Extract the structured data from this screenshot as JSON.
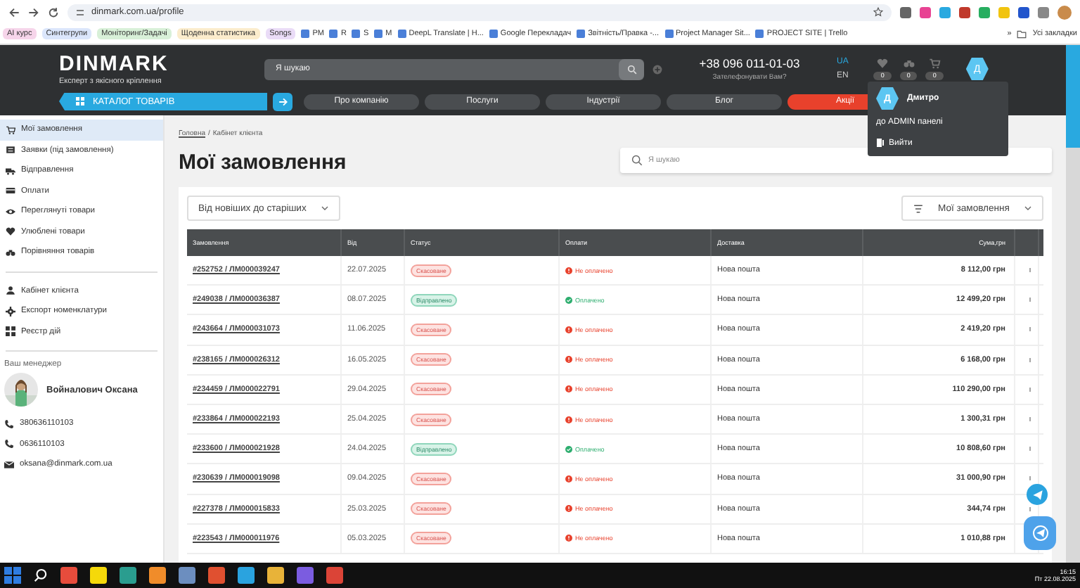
{
  "browser": {
    "url": "dinmark.com.ua/profile",
    "bookmark_tags": [
      {
        "label": "AI курс",
        "color": "#f6d5ea"
      },
      {
        "label": "Синтегрупи",
        "color": "#dbe6fb"
      },
      {
        "label": "Моніторинг/Задачі",
        "color": "#d8f0d8"
      },
      {
        "label": "Щоденна статистика",
        "color": "#fbeccc"
      },
      {
        "label": "Songs",
        "color": "#eadcf7"
      }
    ],
    "bookmark_links": [
      "PM",
      "R",
      "S",
      "M",
      "DeepL Translate | H...",
      "Google Перекладач",
      "Звітність/Правка -...",
      "Project Manager Sit...",
      "PROJECT SITE | Trello"
    ],
    "more": "»",
    "all_bookmarks": "Усі закладки"
  },
  "header": {
    "logo": "DINMARK",
    "tagline": "Експерт з якісного кріплення",
    "search_placeholder": "Я шукаю",
    "phone": "+38 096 011-01-03",
    "callback": "Зателефонувати Вам?",
    "languages": [
      {
        "label": "UA",
        "selected": true
      },
      {
        "label": "EN",
        "selected": false
      }
    ],
    "counters": [
      "0",
      "0",
      "0"
    ],
    "avatar": "Д"
  },
  "nav": {
    "catalog": "КАТАЛОГ ТОВАРІВ",
    "items": [
      {
        "label": "Про компанію",
        "kind": "normal"
      },
      {
        "label": "Послуги",
        "kind": "normal"
      },
      {
        "label": "Індустрії",
        "kind": "normal"
      },
      {
        "label": "Блог",
        "kind": "normal"
      },
      {
        "label": "Акції",
        "kind": "promo"
      }
    ]
  },
  "user_menu": {
    "avatar": "Д",
    "name": "Дмитро",
    "items": [
      {
        "label": "до ADMIN панелі",
        "kind": "link"
      },
      {
        "label": "Вийти",
        "kind": "logout"
      }
    ]
  },
  "sidebar": {
    "items": [
      {
        "label": "Мої замовлення",
        "kind": "orders",
        "selected": true
      },
      {
        "label": "Заявки (під замовлення)",
        "kind": "requests",
        "selected": false
      },
      {
        "label": "Відправлення",
        "kind": "shipments",
        "selected": false
      },
      {
        "label": "Оплати",
        "kind": "payments",
        "selected": false
      },
      {
        "label": "Переглянуті товари",
        "kind": "viewed",
        "selected": false
      },
      {
        "label": "Улюблені товари",
        "kind": "favorites",
        "selected": false
      },
      {
        "label": "Порівняння товарів",
        "kind": "compare",
        "selected": false
      }
    ],
    "account_items": [
      {
        "label": "Кабінет клієнта",
        "kind": "account",
        "selected": false
      },
      {
        "label": "Експорт номенклатури",
        "kind": "export",
        "selected": false
      },
      {
        "label": "Реєстр дій",
        "kind": "log",
        "selected": false
      }
    ],
    "manager": {
      "title": "Ваш менеджер",
      "name": "Войналович Оксана",
      "contacts": [
        {
          "kind": "phone",
          "text": "380636110103"
        },
        {
          "kind": "phone",
          "text": "0636110103"
        },
        {
          "kind": "email",
          "text": "oksana@dinmark.com.ua"
        }
      ]
    }
  },
  "content": {
    "breadcrumb": [
      "Головна",
      "Кабінет клієнта"
    ],
    "breadcrumb_separator": "/",
    "title": "Мої замовлення",
    "search_placeholder": "Я шукаю",
    "sort": "Від новіших до старіших",
    "filter": "Мої замовлення"
  },
  "table": {
    "columns": [
      "Замовлення",
      "Від",
      "Статус",
      "Оплати",
      "Доставка",
      "Сума,грн"
    ],
    "rows": [
      {
        "order": "#252752 / ЛМ000039247",
        "date": "22.07.2025",
        "status": {
          "text": "Скасоване",
          "kind": "cancelled"
        },
        "payment": {
          "text": "Не оплачено",
          "kind": "unpaid"
        },
        "delivery": "Нова пошта",
        "sum": "8 112,00 грн"
      },
      {
        "order": "#249038 / ЛМ000036387",
        "date": "08.07.2025",
        "status": {
          "text": "Відправлено",
          "kind": "shipped"
        },
        "payment": {
          "text": "Оплачено",
          "kind": "paid"
        },
        "delivery": "Нова пошта",
        "sum": "12 499,20 грн"
      },
      {
        "order": "#243664 / ЛМ000031073",
        "date": "11.06.2025",
        "status": {
          "text": "Скасоване",
          "kind": "cancelled"
        },
        "payment": {
          "text": "Не оплачено",
          "kind": "unpaid"
        },
        "delivery": "Нова пошта",
        "sum": "2 419,20 грн"
      },
      {
        "order": "#238165 / ЛМ000026312",
        "date": "16.05.2025",
        "status": {
          "text": "Скасоване",
          "kind": "cancelled"
        },
        "payment": {
          "text": "Не оплачено",
          "kind": "unpaid"
        },
        "delivery": "Нова пошта",
        "sum": "6 168,00 грн"
      },
      {
        "order": "#234459 / ЛМ000022791",
        "date": "29.04.2025",
        "status": {
          "text": "Скасоване",
          "kind": "cancelled"
        },
        "payment": {
          "text": "Не оплачено",
          "kind": "unpaid"
        },
        "delivery": "Нова пошта",
        "sum": "110 290,00 грн"
      },
      {
        "order": "#233864 / ЛМ000022193",
        "date": "25.04.2025",
        "status": {
          "text": "Скасоване",
          "kind": "cancelled"
        },
        "payment": {
          "text": "Не оплачено",
          "kind": "unpaid"
        },
        "delivery": "Нова пошта",
        "sum": "1 300,31 грн"
      },
      {
        "order": "#233600 / ЛМ000021928",
        "date": "24.04.2025",
        "status": {
          "text": "Відправлено",
          "kind": "shipped"
        },
        "payment": {
          "text": "Оплачено",
          "kind": "paid"
        },
        "delivery": "Нова пошта",
        "sum": "10 808,60 грн"
      },
      {
        "order": "#230639 / ЛМ000019098",
        "date": "09.04.2025",
        "status": {
          "text": "Скасоване",
          "kind": "cancelled"
        },
        "payment": {
          "text": "Не оплачено",
          "kind": "unpaid"
        },
        "delivery": "Нова пошта",
        "sum": "31 000,90 грн"
      },
      {
        "order": "#227378 / ЛМ000015833",
        "date": "25.03.2025",
        "status": {
          "text": "Скасоване",
          "kind": "cancelled"
        },
        "payment": {
          "text": "Не оплачено",
          "kind": "unpaid"
        },
        "delivery": "Нова пошта",
        "sum": "344,74 грн"
      },
      {
        "order": "#223543 / ЛМ000011976",
        "date": "05.03.2025",
        "status": {
          "text": "Скасоване",
          "kind": "cancelled"
        },
        "payment": {
          "text": "Не оплачено",
          "kind": "unpaid"
        },
        "delivery": "Нова пошта",
        "sum": "1 010,88 грн"
      }
    ]
  },
  "taskbar": {
    "time": "16:15",
    "date": "Пт 22.08.2025"
  }
}
